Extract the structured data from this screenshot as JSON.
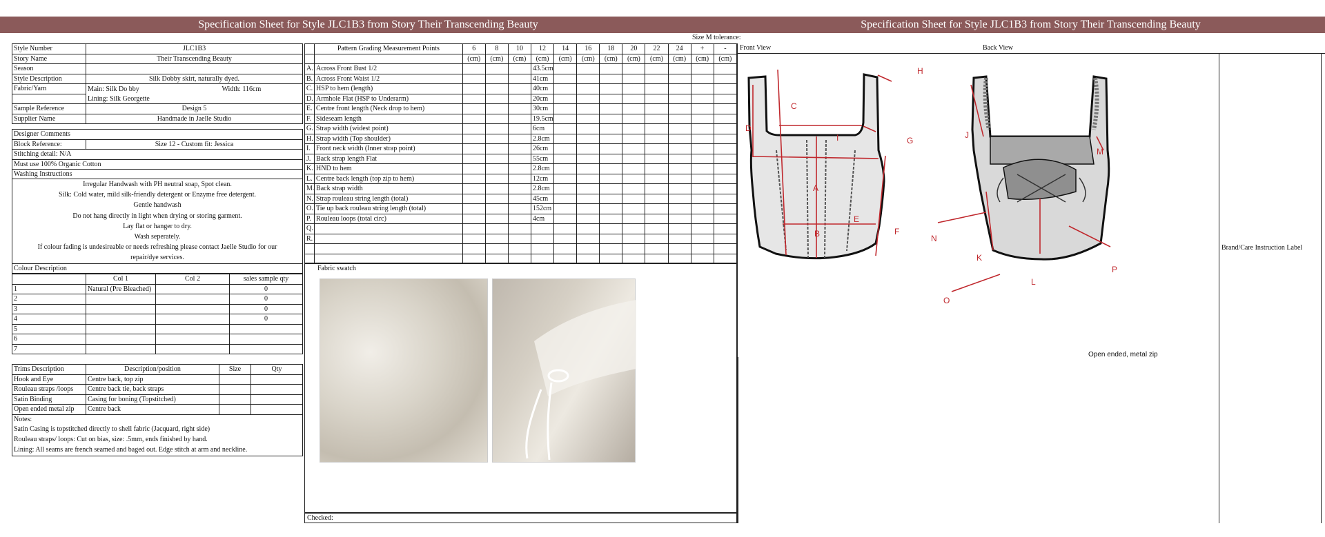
{
  "title": "Specification Sheet for Style JLC1B3 from Story Their Transcending Beauty",
  "info": {
    "style_number_label": "Style Number",
    "style_number": "JLC1B3",
    "story_name_label": "Story Name",
    "story_name": "Their Transcending Beauty",
    "season_label": "Season",
    "season": "",
    "style_desc_label": "Style Description",
    "style_desc": "Silk Dobby skirt, naturally dyed.",
    "fabric_label": "Fabric/Yarn",
    "fabric_main": "Main: Silk Do bby",
    "fabric_width": "Width: 116cm",
    "fabric_lining": "Lining: Silk Georgette",
    "sample_ref_label": "Sample Reference",
    "sample_ref": "Design 5",
    "supplier_label": "Supplier Name",
    "supplier": "Handmade in Jaelle Studio",
    "designer_comments_label": "Designer Comments",
    "block_ref_label": "Block Reference:",
    "block_ref": "Size 12 - Custom fit: Jessica",
    "stitching_label": "Stitching detail: N/A",
    "comment_text": "Must use 100% Organic Cotton"
  },
  "washing": {
    "label": "Washing Instructions",
    "lines": [
      "Irregular Handwash with PH neutral soap, Spot clean.",
      "Silk: Cold water, mild silk-friendly detergent or Enzyme free detergent.",
      "Gentle handwash",
      "Do not hang directly in light when drying or storing garment.",
      "Lay flat or hanger to dry.",
      "Wash seperately.",
      "If colour fading is undesireable or needs refreshing please contact Jaelle Studio for our",
      "repair/dye services."
    ]
  },
  "colour": {
    "label": "Colour Description",
    "headers": [
      "",
      "Col 1",
      "Col 2",
      "sales sample qty"
    ],
    "rows": [
      [
        "1",
        "Natural (Pre Bleached)",
        "",
        "0"
      ],
      [
        "2",
        "",
        "",
        "0"
      ],
      [
        "3",
        "",
        "",
        "0"
      ],
      [
        "4",
        "",
        "",
        "0"
      ],
      [
        "5",
        "",
        "",
        ""
      ],
      [
        "6",
        "",
        "",
        ""
      ],
      [
        "7",
        "",
        "",
        ""
      ]
    ]
  },
  "trims": {
    "headers": [
      "Trims Description",
      "Description/position",
      "Size",
      "Qty"
    ],
    "rows": [
      [
        "Hook and Eye",
        "Centre back, top zip",
        "",
        ""
      ],
      [
        "Rouleau straps /loops",
        "Centre back tie, back straps",
        "",
        ""
      ],
      [
        "Satin Binding",
        "Casing for boning (Topstitched)",
        "",
        ""
      ],
      [
        "Open ended metal zip",
        "Centre back",
        "",
        ""
      ]
    ],
    "notes_label": "Notes:",
    "notes": [
      "Satin Casing is topstitched directly to shell fabric (Jacquard, right side)",
      "Rouleau straps/ loops: Cut on bias, size: .5mm, ends finished by hand.",
      "Lining: All seams are french seamed and baged out. Edge stitch at arm and neckline."
    ]
  },
  "grading": {
    "tolerance_label": "Size M tolerance:",
    "header_title": "Pattern Grading Measurement Points",
    "sizes": [
      "6",
      "8",
      "10",
      "12",
      "14",
      "16",
      "18",
      "20",
      "22",
      "24",
      "+",
      "-"
    ],
    "unit": "(cm)",
    "rows": [
      {
        "letter": "A.",
        "point": "Across Front Bust 1/2",
        "v12": "43.5cm"
      },
      {
        "letter": "B.",
        "point": "Across Front Waist 1/2",
        "v12": "41cm"
      },
      {
        "letter": "C.",
        "point": "HSP to hem (length)",
        "v12": "40cm"
      },
      {
        "letter": "D.",
        "point": "Armhole Flat (HSP to Underarm)",
        "v12": "20cm"
      },
      {
        "letter": "E.",
        "point": "Centre front length (Neck drop to hem)",
        "v12": "30cm"
      },
      {
        "letter": "F.",
        "point": "Sideseam length",
        "v12": "19.5cm"
      },
      {
        "letter": "G.",
        "point": "Strap width (widest point)",
        "v12": "6cm"
      },
      {
        "letter": "H.",
        "point": "Strap width (Top shoulder)",
        "v12": "2.8cm"
      },
      {
        "letter": "I.",
        "point": "Front neck width (Inner strap point)",
        "v12": "26cm"
      },
      {
        "letter": "J.",
        "point": "Back strap length Flat",
        "v12": "55cm"
      },
      {
        "letter": "K.",
        "point": "HND to hem",
        "v12": "2.8cm"
      },
      {
        "letter": "L.",
        "point": "Centre back length (top zip to hem)",
        "v12": "12cm"
      },
      {
        "letter": "M.",
        "point": "Back strap width",
        "v12": "2.8cm"
      },
      {
        "letter": "N.",
        "point": "Strap rouleau string length (total)",
        "v12": "45cm"
      },
      {
        "letter": "O.",
        "point": "Tie up back rouleau string length (total)",
        "v12": "152cm"
      },
      {
        "letter": "P.",
        "point": "Rouleau loops (total circ)",
        "v12": "4cm"
      },
      {
        "letter": "Q.",
        "point": "",
        "v12": ""
      },
      {
        "letter": "R.",
        "point": "",
        "v12": ""
      },
      {
        "letter": "",
        "point": "",
        "v12": ""
      },
      {
        "letter": "",
        "point": "",
        "v12": ""
      }
    ]
  },
  "swatch": {
    "label": "Fabric swatch"
  },
  "checked_label": "Checked:",
  "views": {
    "front_label": "Front View",
    "back_label": "Back View",
    "brand_label": "Brand/Care Instruction Label",
    "zip_note": "Open ended, metal zip",
    "front_letters": [
      "A",
      "B",
      "C",
      "D",
      "E",
      "F",
      "G",
      "H",
      "I"
    ],
    "back_letters": [
      "J",
      "K",
      "L",
      "M",
      "N",
      "O",
      "P"
    ]
  },
  "colors": {
    "title_bar": "#8b5a5a",
    "measure": "#c0282d"
  }
}
